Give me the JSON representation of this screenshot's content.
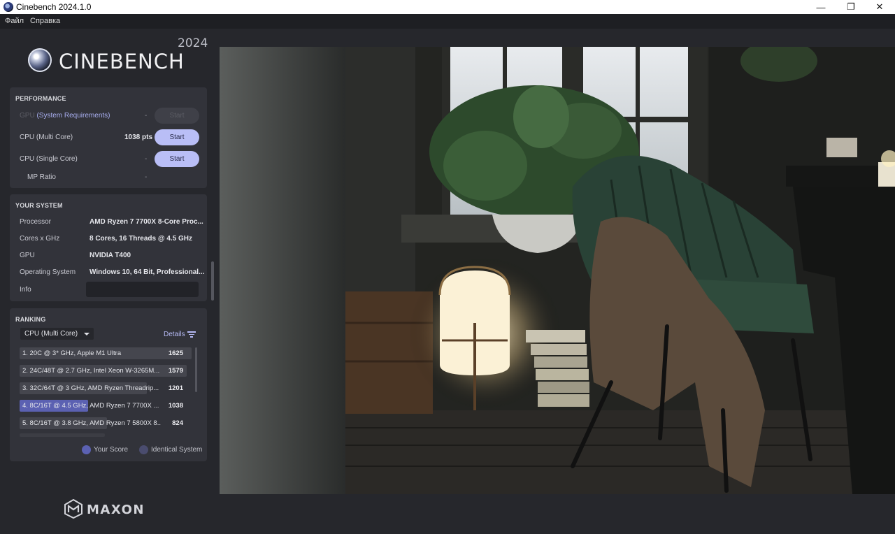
{
  "window": {
    "title": "Cinebench 2024.1.0",
    "minimize": "—",
    "maximize": "❐",
    "close": "✕"
  },
  "menu": [
    "Файл",
    "Справка"
  ],
  "brand": {
    "name": "CINEBENCH",
    "year": "2024",
    "vendor": "MAXON"
  },
  "performance": {
    "title": "PERFORMANCE",
    "gpu": {
      "label_prefix": "GPU",
      "label_link": "(System Requirements)",
      "value": "-",
      "button": "Start"
    },
    "cpu_multi": {
      "label": "CPU (Multi Core)",
      "value": "1038 pts",
      "button": "Start"
    },
    "cpu_single": {
      "label": "CPU (Single Core)",
      "value": "-",
      "button": "Start"
    },
    "mp_ratio": {
      "label": "MP Ratio",
      "value": "-"
    }
  },
  "system": {
    "title": "YOUR SYSTEM",
    "rows": [
      {
        "label": "Processor",
        "value": "AMD Ryzen 7 7700X 8-Core Proc..."
      },
      {
        "label": "Cores x GHz",
        "value": "8 Cores, 16 Threads @ 4.5 GHz"
      },
      {
        "label": "GPU",
        "value": "NVIDIA T400"
      },
      {
        "label": "Operating System",
        "value": "Windows 10, 64 Bit, Professional..."
      },
      {
        "label": "Info",
        "value": ""
      }
    ]
  },
  "ranking": {
    "title": "RANKING",
    "selected_test": "CPU (Multi Core)",
    "details_label": "Details",
    "entries": [
      {
        "label": "1. 20C @ 3* GHz, Apple M1 Ultra",
        "score": "1625",
        "fraction": 1.0,
        "mine": false
      },
      {
        "label": "2. 24C/48T @ 2.7 GHz, Intel Xeon W-3265M...",
        "score": "1579",
        "fraction": 0.97,
        "mine": false
      },
      {
        "label": "3. 32C/64T @ 3 GHz, AMD Ryzen Threadrip...",
        "score": "1201",
        "fraction": 0.74,
        "mine": false
      },
      {
        "label": "4. 8C/16T @ 4.5 GHz, AMD Ryzen 7 7700X ...",
        "score": "1038",
        "fraction": 0.64,
        "mine": true
      },
      {
        "label": "5. 8C/16T @ 3.8 GHz, AMD Ryzen 7 5800X 8...",
        "score": "824",
        "fraction": 0.51,
        "mine": false
      }
    ],
    "legend": {
      "your_score": "Your Score",
      "identical": "Identical System"
    }
  },
  "colors": {
    "accent": "#b9bef6",
    "mine_bar": "#5b61b2",
    "bar": "#45464e",
    "panel": "#32333a"
  }
}
